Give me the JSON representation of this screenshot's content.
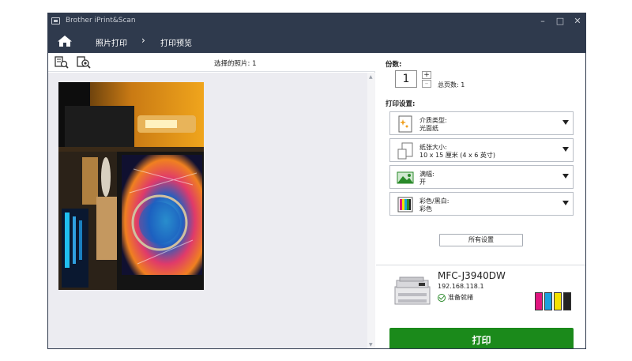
{
  "window": {
    "title": "Brother iPrint&Scan",
    "controls": {
      "minimize": "–",
      "maximize": "□",
      "close": "✕"
    }
  },
  "nav": {
    "home_icon": "home-icon",
    "breadcrumbs": [
      "照片打印",
      "打印预览"
    ],
    "separator": "›"
  },
  "preview": {
    "selected_label": "选择的照片: 1",
    "tools": [
      "fit-page-icon",
      "zoom-icon"
    ]
  },
  "copies": {
    "label": "份数:",
    "value": "1",
    "plus": "+",
    "minus": "–",
    "total_pages": "总页数: 1"
  },
  "settings": {
    "label": "打印设置:",
    "items": [
      {
        "title": "介质类型:",
        "value": "光面纸",
        "icon": "media-type-icon"
      },
      {
        "title": "纸张大小:",
        "value": "10 x 15 厘米 (4 x 6 英寸)",
        "icon": "paper-size-icon"
      },
      {
        "title": "满幅:",
        "value": "开",
        "icon": "borderless-icon"
      },
      {
        "title": "彩色/黑白:",
        "value": "彩色",
        "icon": "color-mode-icon"
      }
    ],
    "all_settings": "所有设置"
  },
  "printer": {
    "name": "MFC-J3940DW",
    "ip": "192.168.118.1",
    "status": "准备就绪",
    "ink_colors": [
      "#e0157f",
      "#1aa0e0",
      "#f2e200",
      "#222222"
    ],
    "ink_levels": [
      0.9,
      0.9,
      0.9,
      0.9
    ]
  },
  "actions": {
    "print": "打印"
  },
  "colors": {
    "titlebar": "#2f3a4d",
    "print_button": "#1b8a1b"
  }
}
